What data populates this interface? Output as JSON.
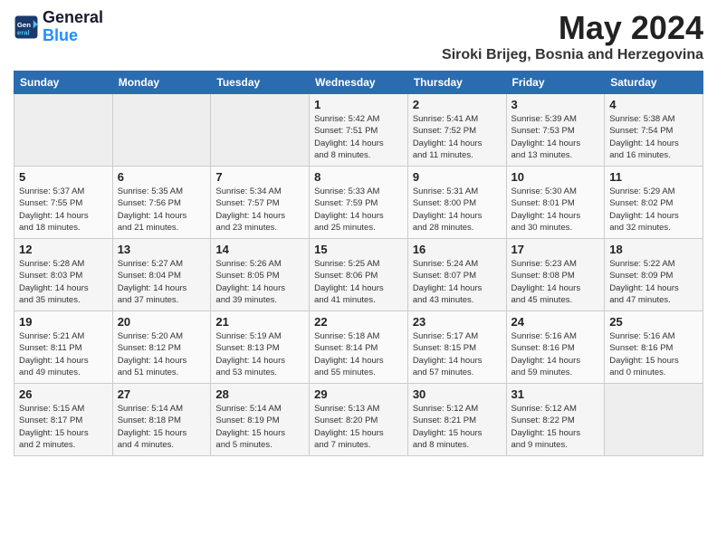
{
  "logo": {
    "line1": "General",
    "line2": "Blue"
  },
  "title": "May 2024",
  "location": "Siroki Brijeg, Bosnia and Herzegovina",
  "weekdays": [
    "Sunday",
    "Monday",
    "Tuesday",
    "Wednesday",
    "Thursday",
    "Friday",
    "Saturday"
  ],
  "weeks": [
    [
      {
        "day": "",
        "info": ""
      },
      {
        "day": "",
        "info": ""
      },
      {
        "day": "",
        "info": ""
      },
      {
        "day": "1",
        "info": "Sunrise: 5:42 AM\nSunset: 7:51 PM\nDaylight: 14 hours\nand 8 minutes."
      },
      {
        "day": "2",
        "info": "Sunrise: 5:41 AM\nSunset: 7:52 PM\nDaylight: 14 hours\nand 11 minutes."
      },
      {
        "day": "3",
        "info": "Sunrise: 5:39 AM\nSunset: 7:53 PM\nDaylight: 14 hours\nand 13 minutes."
      },
      {
        "day": "4",
        "info": "Sunrise: 5:38 AM\nSunset: 7:54 PM\nDaylight: 14 hours\nand 16 minutes."
      }
    ],
    [
      {
        "day": "5",
        "info": "Sunrise: 5:37 AM\nSunset: 7:55 PM\nDaylight: 14 hours\nand 18 minutes."
      },
      {
        "day": "6",
        "info": "Sunrise: 5:35 AM\nSunset: 7:56 PM\nDaylight: 14 hours\nand 21 minutes."
      },
      {
        "day": "7",
        "info": "Sunrise: 5:34 AM\nSunset: 7:57 PM\nDaylight: 14 hours\nand 23 minutes."
      },
      {
        "day": "8",
        "info": "Sunrise: 5:33 AM\nSunset: 7:59 PM\nDaylight: 14 hours\nand 25 minutes."
      },
      {
        "day": "9",
        "info": "Sunrise: 5:31 AM\nSunset: 8:00 PM\nDaylight: 14 hours\nand 28 minutes."
      },
      {
        "day": "10",
        "info": "Sunrise: 5:30 AM\nSunset: 8:01 PM\nDaylight: 14 hours\nand 30 minutes."
      },
      {
        "day": "11",
        "info": "Sunrise: 5:29 AM\nSunset: 8:02 PM\nDaylight: 14 hours\nand 32 minutes."
      }
    ],
    [
      {
        "day": "12",
        "info": "Sunrise: 5:28 AM\nSunset: 8:03 PM\nDaylight: 14 hours\nand 35 minutes."
      },
      {
        "day": "13",
        "info": "Sunrise: 5:27 AM\nSunset: 8:04 PM\nDaylight: 14 hours\nand 37 minutes."
      },
      {
        "day": "14",
        "info": "Sunrise: 5:26 AM\nSunset: 8:05 PM\nDaylight: 14 hours\nand 39 minutes."
      },
      {
        "day": "15",
        "info": "Sunrise: 5:25 AM\nSunset: 8:06 PM\nDaylight: 14 hours\nand 41 minutes."
      },
      {
        "day": "16",
        "info": "Sunrise: 5:24 AM\nSunset: 8:07 PM\nDaylight: 14 hours\nand 43 minutes."
      },
      {
        "day": "17",
        "info": "Sunrise: 5:23 AM\nSunset: 8:08 PM\nDaylight: 14 hours\nand 45 minutes."
      },
      {
        "day": "18",
        "info": "Sunrise: 5:22 AM\nSunset: 8:09 PM\nDaylight: 14 hours\nand 47 minutes."
      }
    ],
    [
      {
        "day": "19",
        "info": "Sunrise: 5:21 AM\nSunset: 8:11 PM\nDaylight: 14 hours\nand 49 minutes."
      },
      {
        "day": "20",
        "info": "Sunrise: 5:20 AM\nSunset: 8:12 PM\nDaylight: 14 hours\nand 51 minutes."
      },
      {
        "day": "21",
        "info": "Sunrise: 5:19 AM\nSunset: 8:13 PM\nDaylight: 14 hours\nand 53 minutes."
      },
      {
        "day": "22",
        "info": "Sunrise: 5:18 AM\nSunset: 8:14 PM\nDaylight: 14 hours\nand 55 minutes."
      },
      {
        "day": "23",
        "info": "Sunrise: 5:17 AM\nSunset: 8:15 PM\nDaylight: 14 hours\nand 57 minutes."
      },
      {
        "day": "24",
        "info": "Sunrise: 5:16 AM\nSunset: 8:16 PM\nDaylight: 14 hours\nand 59 minutes."
      },
      {
        "day": "25",
        "info": "Sunrise: 5:16 AM\nSunset: 8:16 PM\nDaylight: 15 hours\nand 0 minutes."
      }
    ],
    [
      {
        "day": "26",
        "info": "Sunrise: 5:15 AM\nSunset: 8:17 PM\nDaylight: 15 hours\nand 2 minutes."
      },
      {
        "day": "27",
        "info": "Sunrise: 5:14 AM\nSunset: 8:18 PM\nDaylight: 15 hours\nand 4 minutes."
      },
      {
        "day": "28",
        "info": "Sunrise: 5:14 AM\nSunset: 8:19 PM\nDaylight: 15 hours\nand 5 minutes."
      },
      {
        "day": "29",
        "info": "Sunrise: 5:13 AM\nSunset: 8:20 PM\nDaylight: 15 hours\nand 7 minutes."
      },
      {
        "day": "30",
        "info": "Sunrise: 5:12 AM\nSunset: 8:21 PM\nDaylight: 15 hours\nand 8 minutes."
      },
      {
        "day": "31",
        "info": "Sunrise: 5:12 AM\nSunset: 8:22 PM\nDaylight: 15 hours\nand 9 minutes."
      },
      {
        "day": "",
        "info": ""
      }
    ]
  ]
}
